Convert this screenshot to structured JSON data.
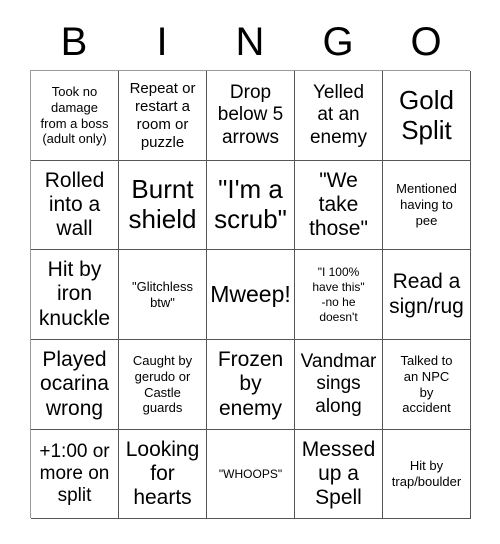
{
  "card": {
    "title": "BINGO",
    "header_letters": [
      "B",
      "I",
      "N",
      "G",
      "O"
    ],
    "grid_size": "5x5",
    "colors": {
      "background": "#ffffff",
      "text": "#000000",
      "cell_border": "#555555",
      "outer_border": "#9a9a9a"
    },
    "rows": [
      [
        {
          "text": "Took no\ndamage\nfrom a boss\n(adult only)",
          "size": "xs"
        },
        {
          "text": "Repeat or\nrestart a\nroom or\npuzzle",
          "size": "sm"
        },
        {
          "text": "Drop\nbelow 5\narrows",
          "size": "md"
        },
        {
          "text": "Yelled\nat an\nenemy",
          "size": "md"
        },
        {
          "text": "Gold\nSplit",
          "size": "xxl"
        }
      ],
      [
        {
          "text": "Rolled\ninto a\nwall",
          "size": "lg"
        },
        {
          "text": "Burnt\nshield",
          "size": "xxl"
        },
        {
          "text": "\"I'm a\nscrub\"",
          "size": "xxl"
        },
        {
          "text": "\"We\ntake\nthose\"",
          "size": "lg"
        },
        {
          "text": "Mentioned\nhaving to\npee",
          "size": "xs"
        }
      ],
      [
        {
          "text": "Hit by\niron\nknuckle",
          "size": "lg"
        },
        {
          "text": "\"Glitchless\nbtw\"",
          "size": "xs"
        },
        {
          "text": "Mweep!",
          "size": "xl"
        },
        {
          "text": "\"I 100%\nhave this\"\n-no he\ndoesn't",
          "size": "xxs"
        },
        {
          "text": "Read a\nsign/rug",
          "size": "lg"
        }
      ],
      [
        {
          "text": "Played\nocarina\nwrong",
          "size": "lg"
        },
        {
          "text": "Caught by\ngerudo or\nCastle\nguards",
          "size": "xs"
        },
        {
          "text": "Frozen\nby\nenemy",
          "size": "lg"
        },
        {
          "text": "Vandmar\nsings\nalong",
          "size": "md"
        },
        {
          "text": "Talked to\nan NPC\nby\naccident",
          "size": "xs"
        }
      ],
      [
        {
          "text": "+1:00 or\nmore on\nsplit",
          "size": "md"
        },
        {
          "text": "Looking\nfor\nhearts",
          "size": "lg"
        },
        {
          "text": "\"WHOOPS\"",
          "size": "xxs"
        },
        {
          "text": "Messed\nup a\nSpell",
          "size": "lg"
        },
        {
          "text": "Hit by\ntrap/boulder",
          "size": "xs"
        }
      ]
    ]
  }
}
